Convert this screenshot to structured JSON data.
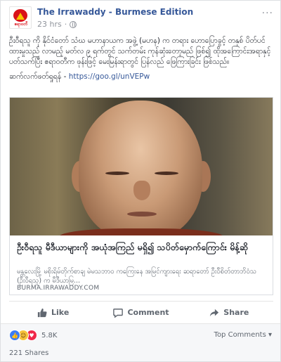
{
  "post": {
    "page_name": "The Irrawaddy - Burmese Edition",
    "timestamp": "23 hrs",
    "avatar_label": "ဧရာဝတီ",
    "more_glyph": "···",
    "body_text": "ဦးဝီရသူ ကို နိုင်ငံတော် သံဃ မဟာနာယက အဖွဲ့ (မဟန) က တရား ဟောပြောခွင့် တနှစ် ပိတ်ပင် ထားမှုသည် လာမည့် မတ်လ ၉ ရက်တွင် သက်တမ်း ကုန်ဆုံးတော့မည် ဖြစ်၍ ထိုအကြောင်းအရာနှင့် ပတ်သက်ပြီး ဧရာဝတီက ဖုန်းဖြင့် မေးမြန်းရာတွင် ပြန်လည် ဖြေကြားခြင်း ဖြစ်သည်။",
    "link_prefix": "ဆက်လက်ဖတ်ရှုရန် - ",
    "link_url": "https://goo.gl/unVEPw"
  },
  "preview": {
    "image_alt": "monk-portrait",
    "title": "ဦးဝီရသူ မီဒီယာများကို အယုံအကြည် မရှိ၍ သပိတ်မှောက်ကြောင်း မိန့်ဆို",
    "description": "မန္တလေးမြို့ မစိုးရိမ်တိုက်စာချ မဲမသဘာဝ ကကြေးနေ အမြင်ကျားရေး ဆရာတော် ဦးဝီစိတ်တာဘိဝံသ (ဦးဝီရသူ) က မီဒီယာမြ...",
    "domain": "BURMA.IRRAWADDY.COM"
  },
  "actions": {
    "like": "Like",
    "comment": "Comment",
    "share": "Share"
  },
  "summary": {
    "reaction_count": "5.8K",
    "comments_filter": "Top Comments ▾",
    "shares": "221 Shares"
  },
  "colors": {
    "link": "#365899",
    "brand_red": "#d9131a",
    "like_blue": "#3b7cf6"
  }
}
